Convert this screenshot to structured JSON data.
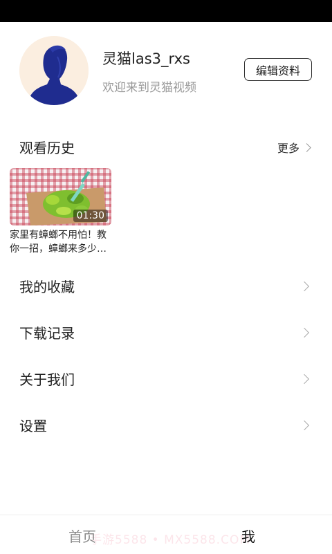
{
  "profile": {
    "username": "灵猫las3_rxs",
    "welcome": "欢迎来到灵猫视频",
    "edit_button": "编辑资料",
    "avatar_icon": "user-silhouette-icon"
  },
  "history": {
    "title": "观看历史",
    "more": "更多",
    "items": [
      {
        "duration": "01:30",
        "title": "家里有蟑螂不用怕！教你一招，蟑螂来多少…"
      }
    ]
  },
  "menu": {
    "items": [
      {
        "label": "我的收藏"
      },
      {
        "label": "下载记录"
      },
      {
        "label": "关于我们"
      },
      {
        "label": "设置"
      }
    ]
  },
  "tabbar": {
    "home": "首页",
    "me": "我",
    "watermark": "手游5588 • MX5588.COM"
  },
  "colors": {
    "avatar_bg": "#fbeee0",
    "avatar_figure": "#1f2c8f",
    "status_bar": "#000000"
  }
}
